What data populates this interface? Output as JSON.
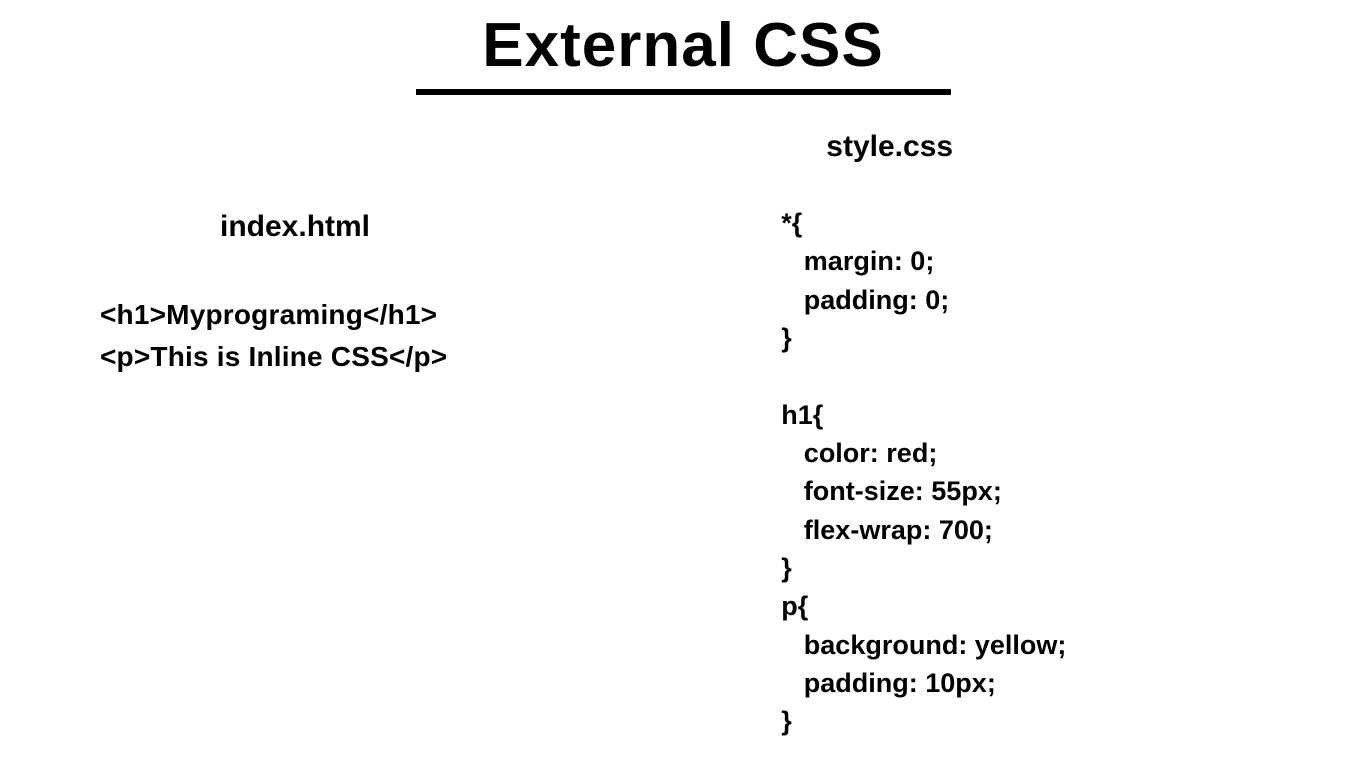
{
  "title": "External CSS",
  "left": {
    "filename": "index.html",
    "line1": "<h1>Myprograming</h1>",
    "line2": "<p>This is Inline CSS</p>"
  },
  "right": {
    "filename": "style.css",
    "css": "*{\n   margin: 0;\n   padding: 0;\n}\n\nh1{\n   color: red;\n   font-size: 55px;\n   flex-wrap: 700;\n}\np{\n   background: yellow;\n   padding: 10px;\n}"
  }
}
